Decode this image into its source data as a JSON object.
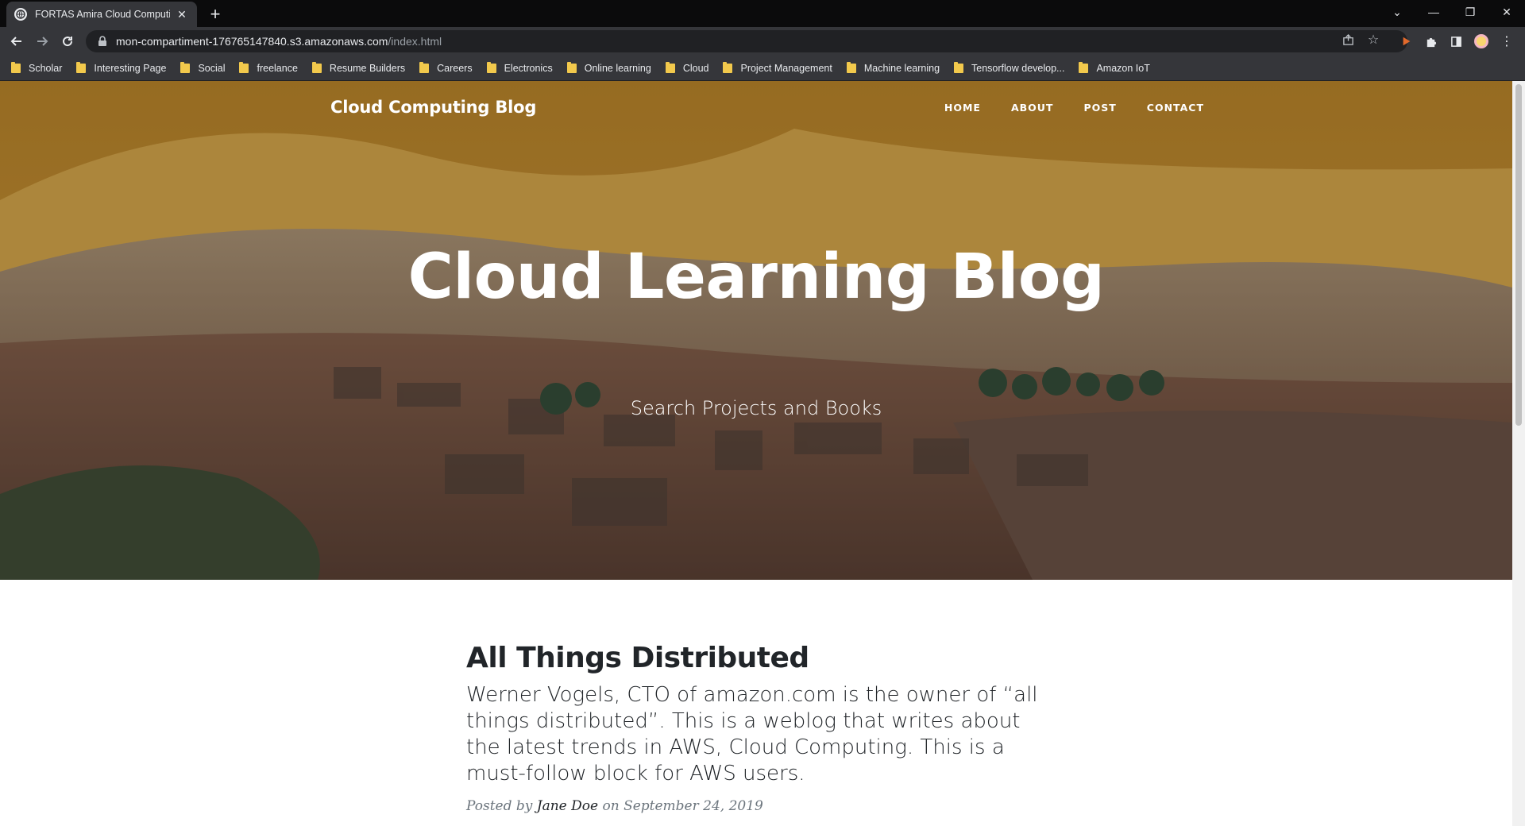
{
  "browser": {
    "tab_title": "FORTAS Amira Cloud Computing",
    "url_host": "mon-compartiment-176765147840.s3.amazonaws.com",
    "url_path": "/index.html",
    "bookmarks": [
      "Scholar",
      "Interesting Page",
      "Social",
      "freelance",
      "Resume Builders",
      "Careers",
      "Electronics",
      "Online learning",
      "Cloud",
      "Project Management",
      "Machine learning",
      "Tensorflow develop...",
      "Amazon IoT"
    ]
  },
  "site": {
    "brand": "Cloud Computing Blog",
    "nav": {
      "home": "HOME",
      "about": "ABOUT",
      "post": "POST",
      "contact": "CONTACT"
    },
    "hero": {
      "title": "Cloud Learning Blog",
      "subtitle": "Search Projects and Books"
    },
    "post": {
      "title": "All Things Distributed",
      "subtitle": "Werner Vogels, CTO of amazon.com is the owner of “all things distributed”. This is a weblog that writes about the latest trends in AWS, Cloud Computing. This is a must-follow block for AWS users.",
      "posted_by": "Posted by",
      "author": "Jane Doe",
      "on": "on",
      "date": "September 24, 2019"
    }
  },
  "colors": {
    "chrome_dark": "#35363a",
    "tabstrip": "#0b0b0c",
    "omnibox": "#202124",
    "heading_text": "#212529",
    "meta_text": "#6c757d"
  }
}
